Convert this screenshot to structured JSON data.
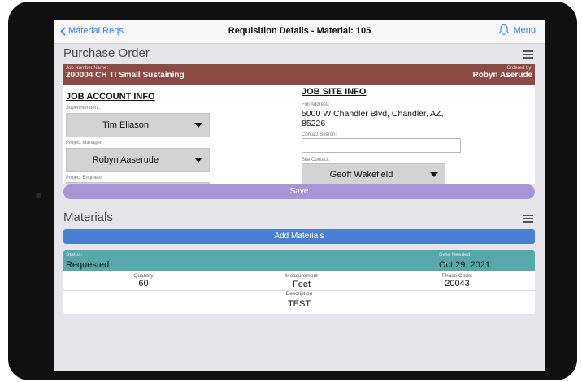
{
  "nav": {
    "back_label": "Material Reqs",
    "title": "Requisition Details - Material: 105",
    "menu_label": "Menu"
  },
  "purchase_order": {
    "title": "Purchase Order",
    "job_label": "Job Number/Name:",
    "job_value": "200004 CH TI Small Sustaining",
    "ordered_by_label": "Ordered by:",
    "ordered_by_value": "Robyn Aserude"
  },
  "job_account": {
    "heading": "JOB ACCOUNT INFO",
    "superintendent_label": "Superintendent:",
    "superintendent_value": "Tim Eliason",
    "project_manager_label": "Project Manager",
    "project_manager_value": "Robyn Aaserude",
    "project_engineer_label": "Project Engineer"
  },
  "job_site": {
    "heading": "JOB SITE INFO",
    "address_label": "Full Address:",
    "address_value": "5000 W Chandler Blvd, Chandler, AZ, 85226",
    "contact_search_label": "Contact Search:",
    "contact_search_value": "",
    "site_contact_label": "Site Contact:",
    "site_contact_value": "Geoff Wakefield"
  },
  "save_label": "Save",
  "materials": {
    "title": "Materials",
    "add_label": "Add Materials",
    "items": [
      {
        "status_label": "Status:",
        "status_value": "Requested",
        "date_label": "Date Needed",
        "date_value": "Oct 29, 2021",
        "quantity_label": "Quantity",
        "quantity_value": "60",
        "measurement_label": "Measurement",
        "measurement_value": "Feet",
        "phase_label": "Phase Code:",
        "phase_value": "20043",
        "description_label": "Description",
        "description_value": "TEST"
      }
    ]
  },
  "colors": {
    "accent": "#2f7cf6",
    "job_banner": "#8b4a44",
    "save_button": "#a895d6",
    "add_button": "#4a7fd3",
    "status_bar": "#57a8ab"
  }
}
